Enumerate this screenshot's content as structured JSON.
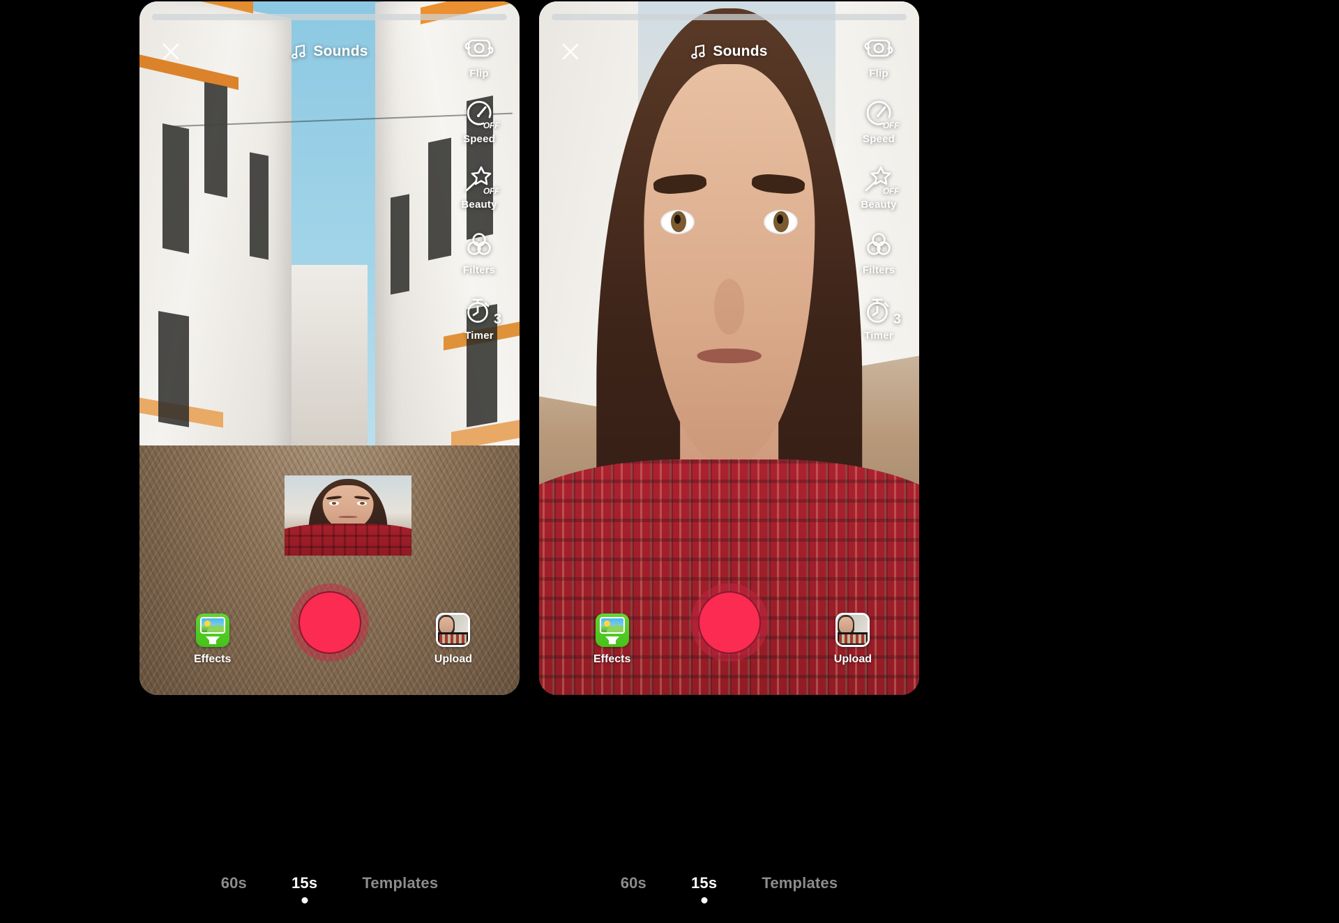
{
  "app": {
    "name": "TikTok Camera",
    "record_color": "#fb2b52",
    "accent_color": "#ffffff",
    "background_color": "#000000"
  },
  "panels": [
    {
      "id": "left",
      "view": "wide-street-with-pip-selfie"
    },
    {
      "id": "right",
      "view": "fullscreen-selfie-closeup"
    }
  ],
  "topbar": {
    "close_icon": "close-icon",
    "sounds_icon": "music-note-icon",
    "sounds_label": "Sounds"
  },
  "rail": {
    "items": [
      {
        "icon": "camera-flip-icon",
        "label": "Flip",
        "badge": ""
      },
      {
        "icon": "speedometer-icon",
        "label": "Speed",
        "badge": "OFF"
      },
      {
        "icon": "magic-wand-icon",
        "label": "Beauty",
        "badge": "OFF"
      },
      {
        "icon": "filters-icon",
        "label": "Filters",
        "badge": ""
      },
      {
        "icon": "stopwatch-icon",
        "label": "Timer",
        "badge": "3"
      }
    ]
  },
  "bottom": {
    "effects": {
      "icon": "effects-image-download-icon",
      "label": "Effects"
    },
    "record": {
      "icon": "record-button",
      "label": ""
    },
    "upload": {
      "icon": "upload-thumbnail-icon",
      "label": "Upload"
    }
  },
  "tabs": {
    "items": [
      {
        "label": "60s",
        "active": false
      },
      {
        "label": "15s",
        "active": true
      },
      {
        "label": "Templates",
        "active": false
      }
    ]
  }
}
